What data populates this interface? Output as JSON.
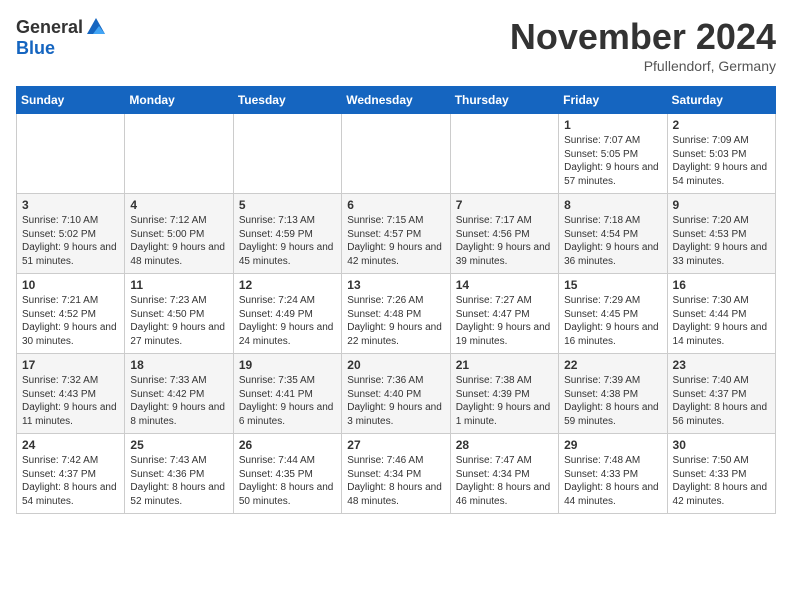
{
  "logo": {
    "general": "General",
    "blue": "Blue"
  },
  "title": "November 2024",
  "location": "Pfullendorf, Germany",
  "days_of_week": [
    "Sunday",
    "Monday",
    "Tuesday",
    "Wednesday",
    "Thursday",
    "Friday",
    "Saturday"
  ],
  "rows": [
    [
      {
        "day": "",
        "info": ""
      },
      {
        "day": "",
        "info": ""
      },
      {
        "day": "",
        "info": ""
      },
      {
        "day": "",
        "info": ""
      },
      {
        "day": "",
        "info": ""
      },
      {
        "day": "1",
        "info": "Sunrise: 7:07 AM\nSunset: 5:05 PM\nDaylight: 9 hours and 57 minutes."
      },
      {
        "day": "2",
        "info": "Sunrise: 7:09 AM\nSunset: 5:03 PM\nDaylight: 9 hours and 54 minutes."
      }
    ],
    [
      {
        "day": "3",
        "info": "Sunrise: 7:10 AM\nSunset: 5:02 PM\nDaylight: 9 hours and 51 minutes."
      },
      {
        "day": "4",
        "info": "Sunrise: 7:12 AM\nSunset: 5:00 PM\nDaylight: 9 hours and 48 minutes."
      },
      {
        "day": "5",
        "info": "Sunrise: 7:13 AM\nSunset: 4:59 PM\nDaylight: 9 hours and 45 minutes."
      },
      {
        "day": "6",
        "info": "Sunrise: 7:15 AM\nSunset: 4:57 PM\nDaylight: 9 hours and 42 minutes."
      },
      {
        "day": "7",
        "info": "Sunrise: 7:17 AM\nSunset: 4:56 PM\nDaylight: 9 hours and 39 minutes."
      },
      {
        "day": "8",
        "info": "Sunrise: 7:18 AM\nSunset: 4:54 PM\nDaylight: 9 hours and 36 minutes."
      },
      {
        "day": "9",
        "info": "Sunrise: 7:20 AM\nSunset: 4:53 PM\nDaylight: 9 hours and 33 minutes."
      }
    ],
    [
      {
        "day": "10",
        "info": "Sunrise: 7:21 AM\nSunset: 4:52 PM\nDaylight: 9 hours and 30 minutes."
      },
      {
        "day": "11",
        "info": "Sunrise: 7:23 AM\nSunset: 4:50 PM\nDaylight: 9 hours and 27 minutes."
      },
      {
        "day": "12",
        "info": "Sunrise: 7:24 AM\nSunset: 4:49 PM\nDaylight: 9 hours and 24 minutes."
      },
      {
        "day": "13",
        "info": "Sunrise: 7:26 AM\nSunset: 4:48 PM\nDaylight: 9 hours and 22 minutes."
      },
      {
        "day": "14",
        "info": "Sunrise: 7:27 AM\nSunset: 4:47 PM\nDaylight: 9 hours and 19 minutes."
      },
      {
        "day": "15",
        "info": "Sunrise: 7:29 AM\nSunset: 4:45 PM\nDaylight: 9 hours and 16 minutes."
      },
      {
        "day": "16",
        "info": "Sunrise: 7:30 AM\nSunset: 4:44 PM\nDaylight: 9 hours and 14 minutes."
      }
    ],
    [
      {
        "day": "17",
        "info": "Sunrise: 7:32 AM\nSunset: 4:43 PM\nDaylight: 9 hours and 11 minutes."
      },
      {
        "day": "18",
        "info": "Sunrise: 7:33 AM\nSunset: 4:42 PM\nDaylight: 9 hours and 8 minutes."
      },
      {
        "day": "19",
        "info": "Sunrise: 7:35 AM\nSunset: 4:41 PM\nDaylight: 9 hours and 6 minutes."
      },
      {
        "day": "20",
        "info": "Sunrise: 7:36 AM\nSunset: 4:40 PM\nDaylight: 9 hours and 3 minutes."
      },
      {
        "day": "21",
        "info": "Sunrise: 7:38 AM\nSunset: 4:39 PM\nDaylight: 9 hours and 1 minute."
      },
      {
        "day": "22",
        "info": "Sunrise: 7:39 AM\nSunset: 4:38 PM\nDaylight: 8 hours and 59 minutes."
      },
      {
        "day": "23",
        "info": "Sunrise: 7:40 AM\nSunset: 4:37 PM\nDaylight: 8 hours and 56 minutes."
      }
    ],
    [
      {
        "day": "24",
        "info": "Sunrise: 7:42 AM\nSunset: 4:37 PM\nDaylight: 8 hours and 54 minutes."
      },
      {
        "day": "25",
        "info": "Sunrise: 7:43 AM\nSunset: 4:36 PM\nDaylight: 8 hours and 52 minutes."
      },
      {
        "day": "26",
        "info": "Sunrise: 7:44 AM\nSunset: 4:35 PM\nDaylight: 8 hours and 50 minutes."
      },
      {
        "day": "27",
        "info": "Sunrise: 7:46 AM\nSunset: 4:34 PM\nDaylight: 8 hours and 48 minutes."
      },
      {
        "day": "28",
        "info": "Sunrise: 7:47 AM\nSunset: 4:34 PM\nDaylight: 8 hours and 46 minutes."
      },
      {
        "day": "29",
        "info": "Sunrise: 7:48 AM\nSunset: 4:33 PM\nDaylight: 8 hours and 44 minutes."
      },
      {
        "day": "30",
        "info": "Sunrise: 7:50 AM\nSunset: 4:33 PM\nDaylight: 8 hours and 42 minutes."
      }
    ]
  ]
}
